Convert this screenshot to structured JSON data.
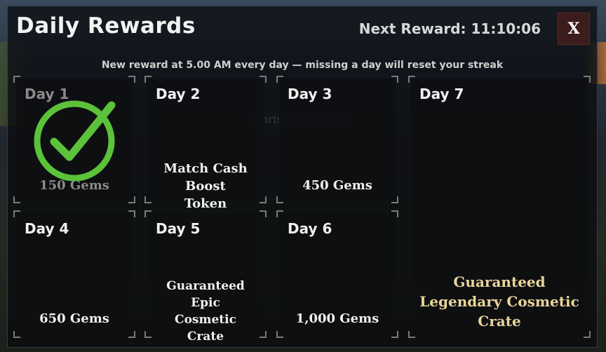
{
  "header": {
    "title": "Daily Rewards",
    "next_reward": "Next Reward: 11:10:06",
    "close_label": "X",
    "subtitle": "New reward at 5.00 AM every day — missing a day will reset your streak"
  },
  "background_text": "Chris ✓ 回 [Lvl. 1]",
  "days": [
    {
      "label": "Day 1",
      "reward": "150 Gems",
      "claimed": true
    },
    {
      "label": "Day 2",
      "reward": "Match Cash Boost Token",
      "claimed": false
    },
    {
      "label": "Day 3",
      "reward": "450 Gems",
      "claimed": false
    },
    {
      "label": "Day 4",
      "reward": "650 Gems",
      "claimed": false
    },
    {
      "label": "Day 5",
      "reward": "Guaranteed Epic Cosmetic Crate",
      "claimed": false
    },
    {
      "label": "Day 6",
      "reward": "1,000 Gems",
      "claimed": false
    },
    {
      "label": "Day 7",
      "reward": "Guaranteed Legendary Cosmetic Crate",
      "claimed": false
    }
  ],
  "colors": {
    "checkmark": "#5bc23a",
    "legendary_text": "#e9d49a",
    "close_bg": "#3c1c1c"
  },
  "icons": {
    "claimed": "checkmark-icon"
  }
}
